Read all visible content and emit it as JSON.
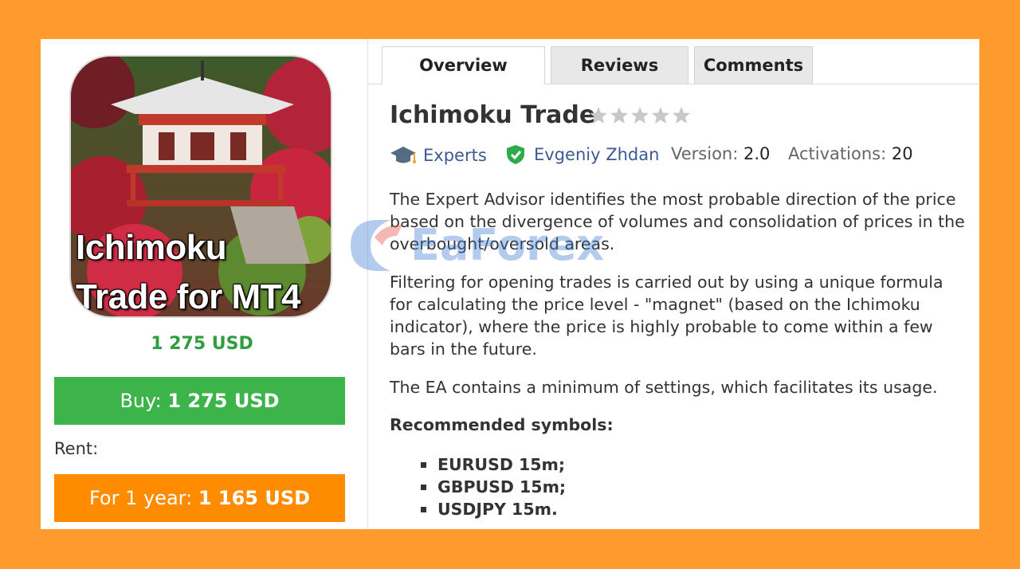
{
  "product": {
    "image_text_line1": "Ichimoku",
    "image_text_line2": "Trade for MT4",
    "price": "1 275 USD",
    "buy_label": "Buy:",
    "buy_value": "1 275 USD",
    "rent_label": "Rent:",
    "rent_button_label": "For 1 year:",
    "rent_button_value": "1 165 USD"
  },
  "tabs": [
    {
      "label": "Overview",
      "active": true
    },
    {
      "label": "Reviews",
      "active": false
    },
    {
      "label": "Comments",
      "active": false
    }
  ],
  "header": {
    "title": "Ichimoku Trade",
    "rating": 0,
    "category": "Experts",
    "author": "Evgeniy Zhdan",
    "version_label": "Version:",
    "version": "2.0",
    "activations_label": "Activations:",
    "activations": "20"
  },
  "description": {
    "p1_line1": "The Expert Advisor identifies the most probable direction of the price",
    "p1_line2": "based on the divergence of volumes and consolidation of prices in the",
    "p1_line3": "overbought/oversold areas.",
    "p2_line1": "Filtering for opening trades is carried out by using a unique formula",
    "p2_line2": "for calculating the price level - \"magnet\" (based on the Ichimoku",
    "p2_line3": "indicator), where the price is highly probable to come within a few",
    "p2_line4": "bars in the future.",
    "p3": "The EA contains a minimum of settings, which facilitates its usage.",
    "recommended_heading": "Recommended symbols:",
    "symbols": [
      "EURUSD 15m;",
      "GBPUSD 15m;",
      "USDJPY  15m."
    ]
  },
  "watermark": "EaForex",
  "colors": {
    "page_background": "#ff9a2e",
    "buy_button": "#3cb449",
    "rent_button": "#ff8c00",
    "price_text": "#2e9e3e",
    "link": "#3b5a91"
  }
}
